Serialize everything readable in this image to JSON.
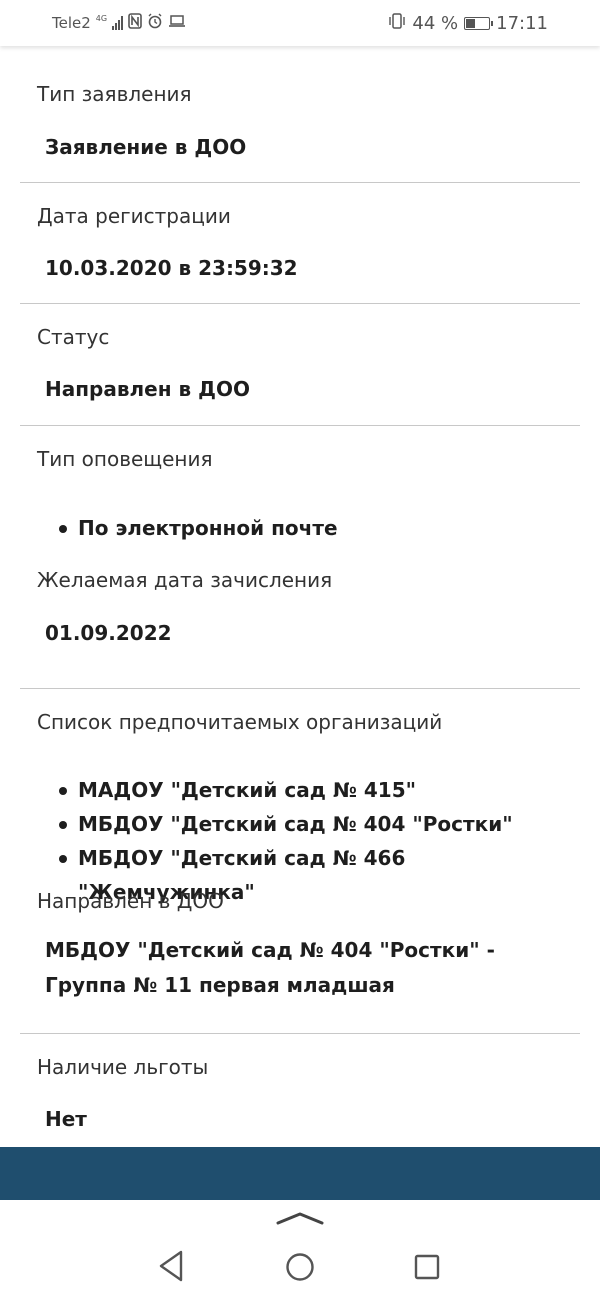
{
  "status_bar": {
    "carrier": "Tele2",
    "network": "4G",
    "battery_percent": "44 %",
    "battery_level": 0.44,
    "time": "17:11"
  },
  "details": {
    "app_type": {
      "label": "Тип заявления",
      "value": "Заявление в ДОО"
    },
    "reg_date": {
      "label": "Дата регистрации",
      "value": "10.03.2020 в 23:59:32"
    },
    "status": {
      "label": "Статус",
      "value": "Направлен в ДОО"
    },
    "notify_type": {
      "label": "Тип оповещения",
      "items": [
        "По электронной почте"
      ]
    },
    "desired_date": {
      "label": "Желаемая дата зачисления",
      "value": "01.09.2022"
    },
    "preferred_orgs": {
      "label": "Список предпочитаемых организаций",
      "items": [
        "МАДОУ \"Детский сад № 415\"",
        "МБДОУ \"Детский сад № 404 \"Ростки\"",
        "МБДОУ \"Детский сад № 466 \"Жемчужинка\""
      ]
    },
    "assigned_doo": {
      "label": "Направлен в ДОО",
      "value": "МБДОУ \"Детский сад № 404 \"Ростки\" - Группа № 11 первая младшая"
    },
    "benefit": {
      "label": "Наличие льготы",
      "value": "Нет"
    }
  },
  "colors": {
    "footer_band": "#1f4e6e",
    "divider": "#c8c8c8"
  }
}
